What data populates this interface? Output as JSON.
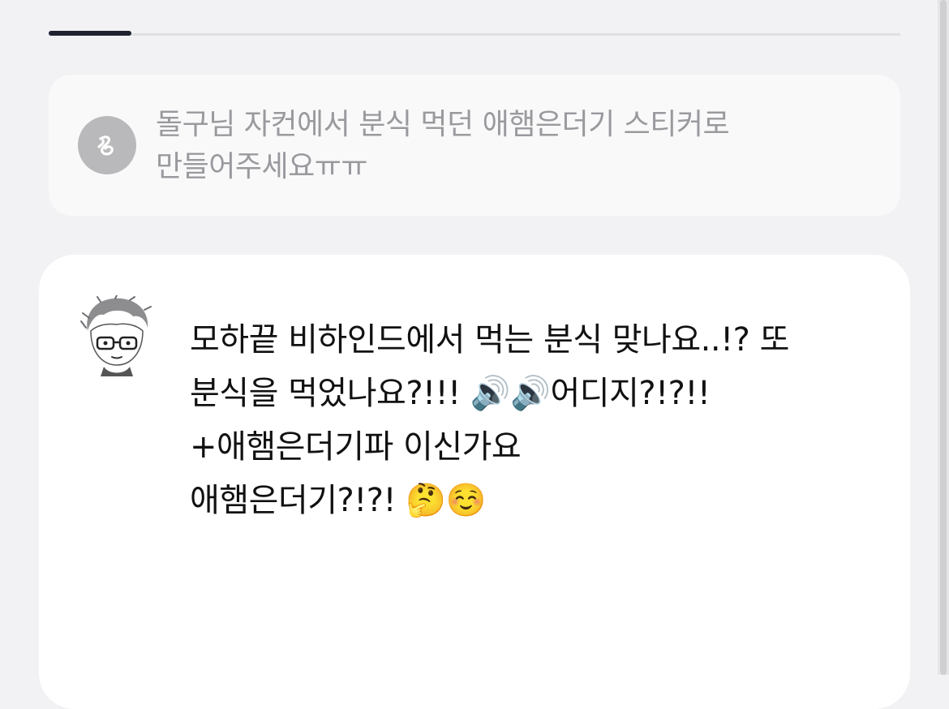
{
  "question": {
    "avatar_icon": "anonymous-user-icon",
    "text": "돌구님 자컨에서 분식 먹던 애햄은더기 스티커로 만들어주세요ㅠㅠ"
  },
  "answer": {
    "avatar_icon": "cartoon-boy-avatar",
    "lines": [
      "모하끝 비하인드에서 먹는 분식 맞나요..!? 또",
      "분식을 먹었나요?!!! 🔊🔊어디지?!?!!",
      "+애햄은더기파 이신가요",
      "애햄은더기?!?! 🤔☺️"
    ]
  },
  "colors": {
    "page_background": "#f2f2f4",
    "question_card": "#f9f9fa",
    "answer_card": "#ffffff",
    "tab_indicator": "#1f2230",
    "question_text": "#9a9a9e"
  }
}
